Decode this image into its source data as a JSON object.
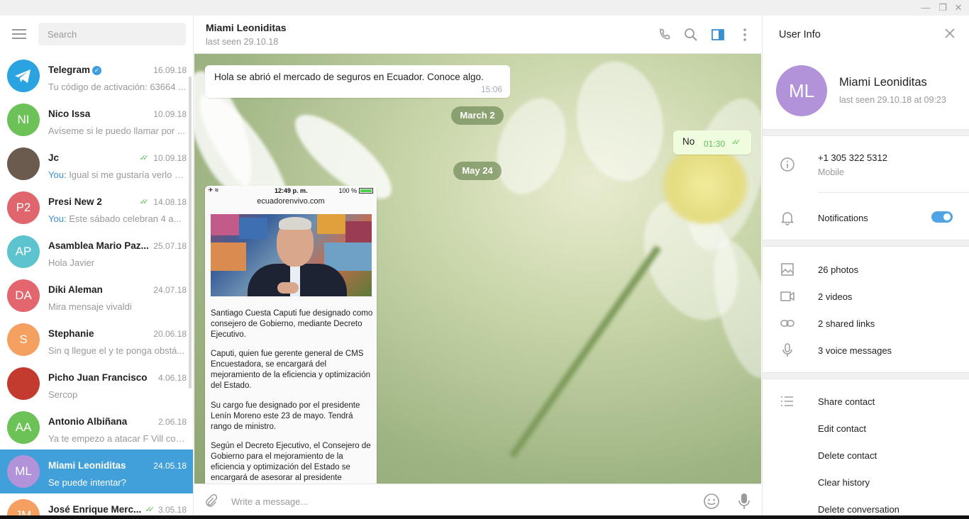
{
  "search": {
    "placeholder": "Search"
  },
  "chats": [
    {
      "name": "Telegram",
      "date": "16.09.18",
      "preview": "Tu código de activación: 63664 ...",
      "initials": "",
      "color": "#2aa3e0",
      "verified": true
    },
    {
      "name": "Nico Issa",
      "date": "10.09.18",
      "preview": "Avíseme si le puedo llamar por ...",
      "initials": "NI",
      "color": "#6cc257"
    },
    {
      "name": "Jc",
      "date": "10.09.18",
      "you": "You:",
      "preview": "Igual si me gustaría verlo s...",
      "initials": "",
      "color": "#6b5a4e",
      "read": true
    },
    {
      "name": "Presi New 2",
      "date": "14.08.18",
      "you": "You:",
      "preview": "Este sábado celebran 4 a...",
      "initials": "P2",
      "color": "#e0666e",
      "read": true
    },
    {
      "name": "Asamblea Mario Paz...",
      "date": "25.07.18",
      "preview": "Hola Javier",
      "initials": "AP",
      "color": "#5cc3cf"
    },
    {
      "name": "Diki Aleman",
      "date": "24.07.18",
      "preview": "Mira mensaje vivaldi",
      "initials": "DA",
      "color": "#e3666f"
    },
    {
      "name": "Stephanie",
      "date": "20.06.18",
      "preview": "Sin q llegue el y te ponga obstá...",
      "initials": "S",
      "color": "#f5a060"
    },
    {
      "name": "Picho Juan Francisco",
      "date": "4.06.18",
      "preview": "Sercop",
      "initials": "",
      "color": "#c33b2f"
    },
    {
      "name": "Antonio Albiñana",
      "date": "2.06.18",
      "preview": "Ya te empezo a atacar F Vill con...",
      "initials": "AA",
      "color": "#6cc257"
    },
    {
      "name": "Miami Leoniditas",
      "date": "24.05.18",
      "preview": "Se puede intentar?",
      "initials": "ML",
      "color": "#b293d9",
      "active": true
    },
    {
      "name": "José Enrique Merc...",
      "date": "3.05.18",
      "preview": "",
      "initials": "JM",
      "color": "#f5a060",
      "read": true
    }
  ],
  "conversation": {
    "title": "Miami Leoniditas",
    "status": "last seen 29.10.18",
    "messages": {
      "incoming_text": "Hola se abrió el mercado de seguros en Ecuador. Conoce algo.",
      "incoming_time": "15:06",
      "date1": "March 2",
      "outgoing_text": "No",
      "outgoing_time": "01:30",
      "date2": "May 24"
    },
    "photo": {
      "status_time": "12:49 p. m.",
      "status_battery": "100 %",
      "url": "ecuadorenvivo.com",
      "p1": "Santiago Cuesta Caputi fue designado como consejero de Gobierno, mediante Decreto Ejecutivo.",
      "p2": "Caputi, quien fue gerente general de CMS Encuestadora, se encargará del mejoramiento de la eficiencia y optimización del Estado.",
      "p3": "Su cargo fue designado por el presidente Lenín Moreno este 23 de mayo. Tendrá rango de ministro.",
      "p4": "Según el Decreto Ejecutivo, el Consejero de Gobierno para el mejoramiento de la eficiencia y optimización del Estado se encargará de asesorar al presidente"
    },
    "composer_placeholder": "Write a message..."
  },
  "user_info": {
    "panel_title": "User Info",
    "initials": "ML",
    "name": "Miami Leoniditas",
    "last_seen": "last seen 29.10.18 at 09:23",
    "phone": "+1 305 322 5312",
    "phone_label": "Mobile",
    "notifications": "Notifications",
    "notifications_on": true,
    "photos": "26 photos",
    "videos": "2 videos",
    "links": "2 shared links",
    "voice": "3 voice messages",
    "share": "Share contact",
    "edit": "Edit contact",
    "delete": "Delete contact",
    "clear": "Clear history",
    "delete_conv": "Delete conversation"
  }
}
